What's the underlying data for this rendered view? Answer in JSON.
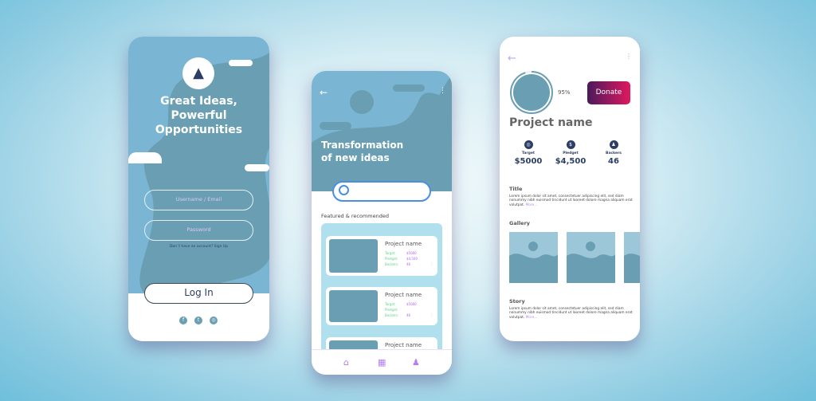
{
  "login": {
    "title_lines": [
      "Great Ideas,",
      "Powerful",
      "Opportunities"
    ],
    "username_placeholder": "Username / Email",
    "password_placeholder": "Password",
    "signup_text": "Don´t have an account? Sign Up",
    "login_label": "Log In",
    "social": [
      "facebook-icon",
      "twitter-icon",
      "instagram-icon"
    ]
  },
  "explore": {
    "title_lines": [
      "Transformation",
      "of new ideas"
    ],
    "section": "Featured & recommended",
    "cards": [
      {
        "name": "Project name",
        "target_label": "Target:",
        "target": "$5000",
        "pledget_label": "Pledget:",
        "pledget": "$4,500",
        "backers_label": "Backers:",
        "backers": "46"
      },
      {
        "name": "Project name",
        "target_label": "Target:",
        "target": "$5000",
        "pledget_label": "Pledget:",
        "pledget": "",
        "backers_label": "Backers:",
        "backers": "46"
      },
      {
        "name": "Project name"
      }
    ],
    "nav": [
      "home-icon",
      "grid-icon",
      "profile-icon"
    ]
  },
  "detail": {
    "progress_percent": 95,
    "progress_label": "95%",
    "donate": "Donate",
    "project_name": "Project name",
    "stats": [
      {
        "label": "Target",
        "value": "$5000"
      },
      {
        "label": "Pledget",
        "value": "$4,500"
      },
      {
        "label": "Backers",
        "value": "46"
      }
    ],
    "title_heading": "Title",
    "lorem": "Lorem ipsum dolor sit amet, consectetuer adipiscing elit, sed diam nonummy nibh euismod tincidunt ut laoreet dolore magna aliquam erat volutpat.",
    "more": "More...",
    "gallery_heading": "Gallery",
    "story_heading": "Story"
  },
  "colors": {
    "sky": "#7ab6d3",
    "dark_blob": "#6a9fb3",
    "navy": "#2c3e66",
    "donate_from": "#4a1a5c",
    "donate_to": "#e0185f",
    "accent": "#b260f0"
  }
}
